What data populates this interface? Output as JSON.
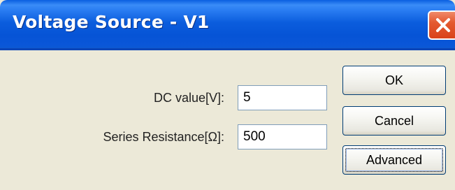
{
  "window": {
    "title": "Voltage Source - V1"
  },
  "icons": {
    "close": "close-icon"
  },
  "colors": {
    "titlebar": "#0a5fe0",
    "close_button": "#e45a30",
    "dialog_background": "#ece9d8",
    "textbox_border": "#7f9db9",
    "button_border": "#003c74"
  },
  "form": {
    "dc_value": {
      "label": "DC value[V]:",
      "value": "5"
    },
    "series_resistance": {
      "label": "Series Resistance[Ω]:",
      "value": "500"
    }
  },
  "buttons": {
    "ok": "OK",
    "cancel": "Cancel",
    "advanced": "Advanced"
  }
}
